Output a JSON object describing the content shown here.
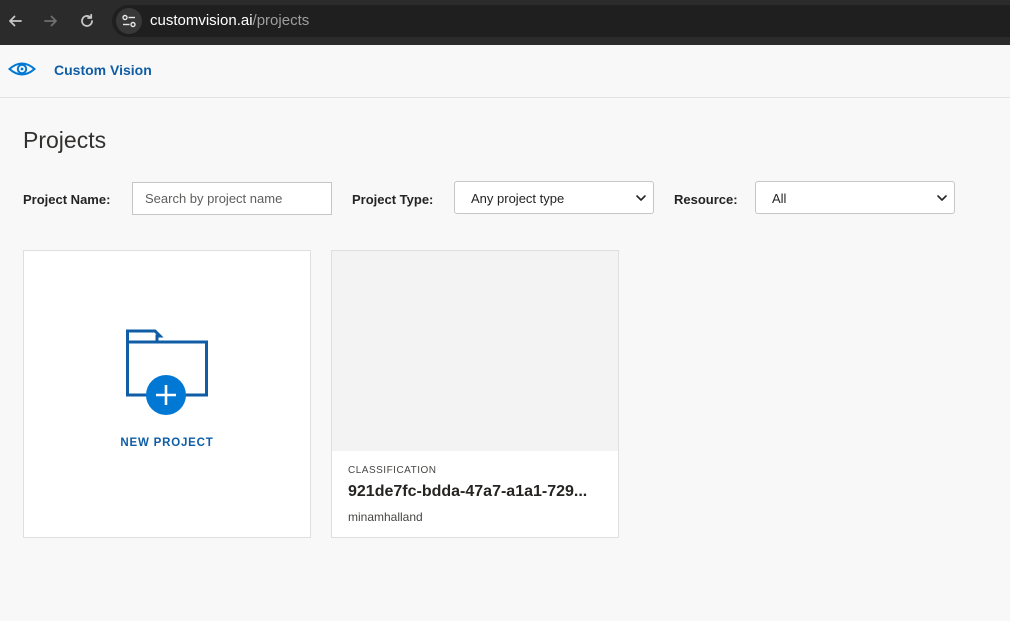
{
  "browser": {
    "url_host": "customvision.ai",
    "url_path": "/projects"
  },
  "app": {
    "title": "Custom Vision",
    "brand_color": "#0f5da5",
    "accent_color": "#0078d4"
  },
  "page": {
    "title": "Projects"
  },
  "filters": {
    "project_name_label": "Project Name:",
    "search_placeholder": "Search by project name",
    "project_type_label": "Project Type:",
    "project_type_value": "Any project type",
    "resource_label": "Resource:",
    "resource_value": "All"
  },
  "cards": {
    "new_project_label": "NEW PROJECT",
    "projects": [
      {
        "type": "CLASSIFICATION",
        "name": "921de7fc-bdda-47a7-a1a1-729...",
        "owner": "minamhalland"
      }
    ]
  }
}
